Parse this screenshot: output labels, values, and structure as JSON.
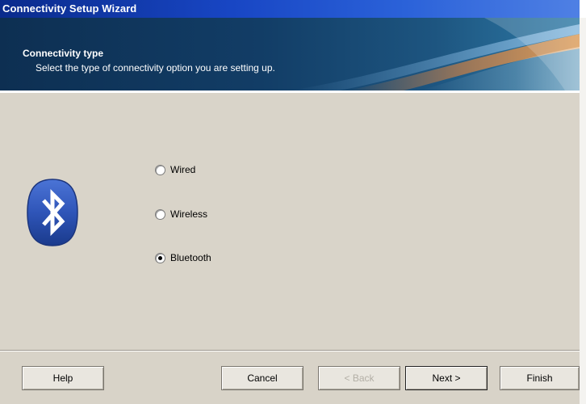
{
  "window": {
    "title": "Connectivity Setup Wizard"
  },
  "header": {
    "heading": "Connectivity type",
    "subheading": "Select the type of connectivity option you are setting up."
  },
  "options": [
    {
      "label": "Wired",
      "checked": false
    },
    {
      "label": "Wireless",
      "checked": false
    },
    {
      "label": "Bluetooth",
      "checked": true
    }
  ],
  "buttons": {
    "help": "Help",
    "cancel": "Cancel",
    "back": "< Back",
    "next": "Next >",
    "finish": "Finish"
  },
  "colors": {
    "title_bar": "#1846c4",
    "banner": "#123d66",
    "dialog_bg": "#d9d4c9",
    "bluetooth_blue": "#2f55b8"
  },
  "icons": {
    "logo": "bluetooth-logo-icon"
  }
}
